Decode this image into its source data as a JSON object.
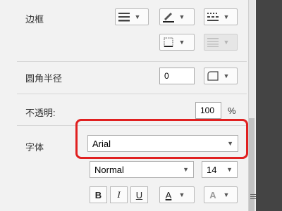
{
  "border": {
    "label": "边框",
    "line_style_icon": "line-style-icon",
    "pen_color_icon": "pen-color-icon",
    "dash_style_icon": "dash-style-icon",
    "border_box_icon": "border-box-icon",
    "align_icon": "align-lines-icon"
  },
  "corner_radius": {
    "label": "圆角半径",
    "value": "0",
    "shape_icon": "rounded-corner-icon"
  },
  "opacity": {
    "label": "不透明:",
    "value": "100",
    "unit": "%"
  },
  "font": {
    "label": "字体",
    "family": "Arial",
    "style": "Normal",
    "size": "14",
    "bold": "B",
    "italic": "I",
    "underline": "U",
    "font_color_letter": "A",
    "text_effect_letter": "A"
  },
  "colors": {
    "highlight": "#e02020",
    "font_color_bar": "#1a1a1a"
  }
}
